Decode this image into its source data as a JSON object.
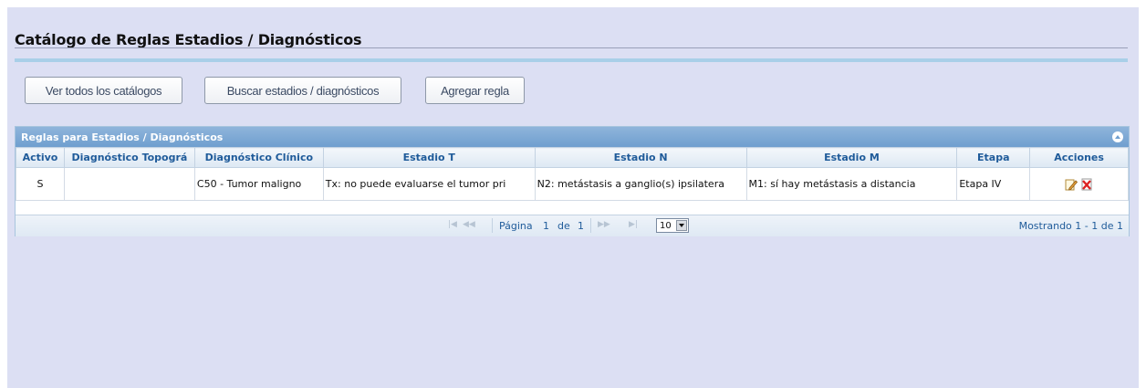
{
  "page": {
    "title": "Catálogo de Reglas Estadios / Diagnósticos"
  },
  "buttons": {
    "view_all": "Ver todos los catálogos",
    "search": "Buscar estadios / diagnósticos",
    "add_rule": "Agregar regla"
  },
  "grid": {
    "caption": "Reglas para Estadios / Diagnósticos",
    "columns": [
      "Activo",
      "Diagnóstico Topográ",
      "Diagnóstico Clínico",
      "Estadio T",
      "Estadio N",
      "Estadio M",
      "Etapa",
      "Acciones"
    ],
    "rows": [
      {
        "activo": "S",
        "topografico": "",
        "clinico": "C50 - Tumor maligno",
        "estadio_t": "Tx: no puede evaluarse el tumor pri",
        "estadio_n": "N2: metástasis a ganglio(s) ipsilatera",
        "estadio_m": "M1: sí hay metástasis a distancia",
        "etapa": "Etapa IV",
        "actions": [
          "edit-icon",
          "delete-icon"
        ]
      }
    ]
  },
  "pager": {
    "page_label": "Página",
    "page": "1",
    "of_label": "de",
    "total_pages": "1",
    "rows_per_page": "10",
    "records": "Mostrando 1 - 1 de 1"
  },
  "colors": {
    "background": "#dcdff3",
    "caption": "#7ea9d5",
    "header_text": "#1f5b9a"
  }
}
